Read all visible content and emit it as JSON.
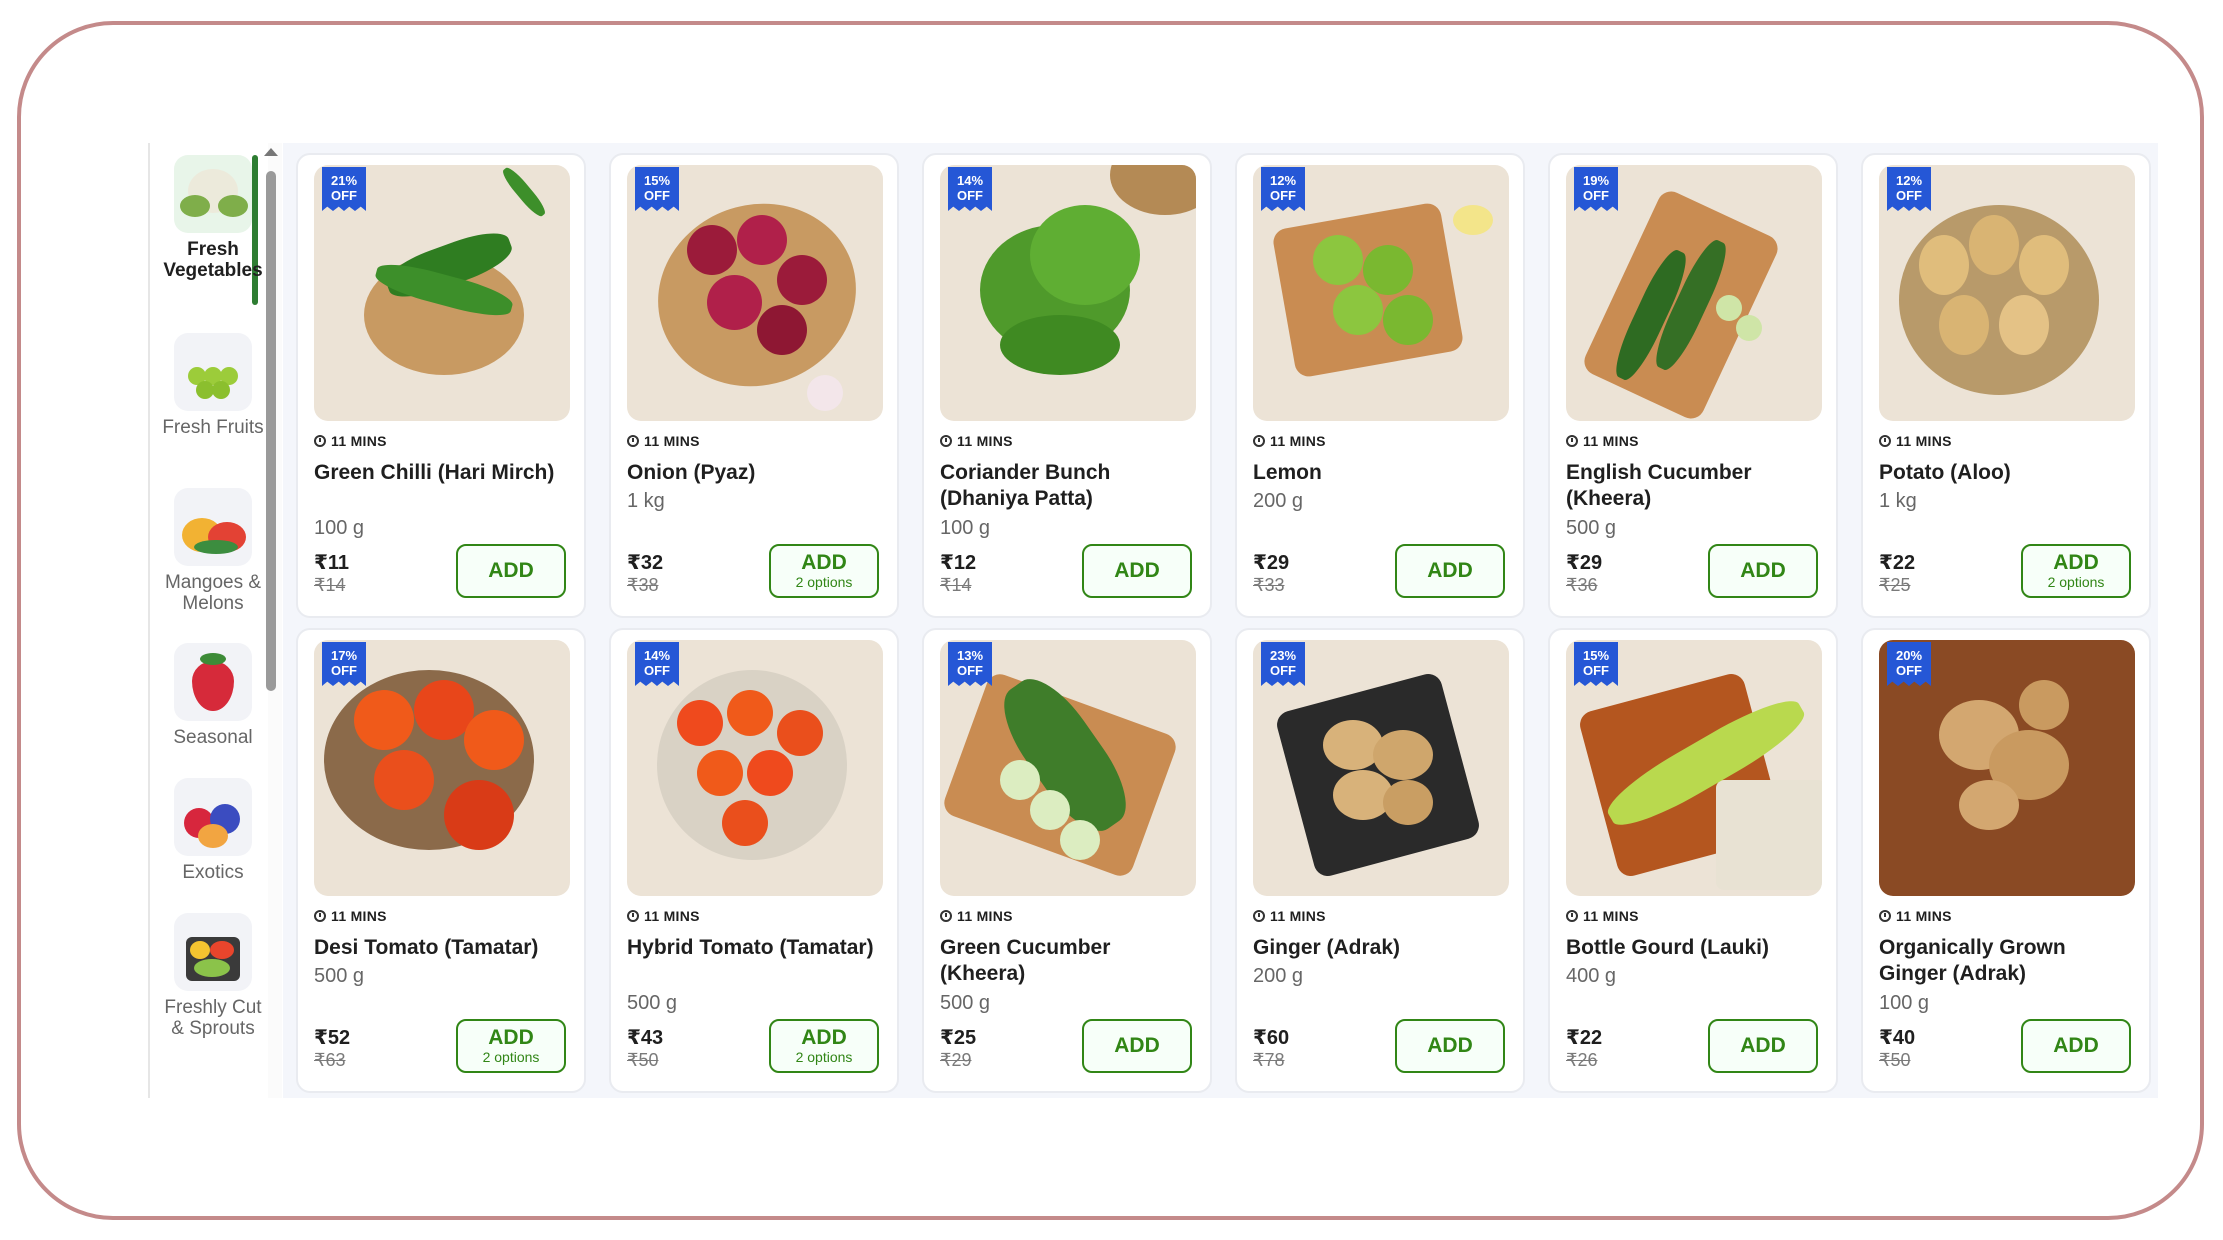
{
  "sidebar": {
    "categories": [
      {
        "label": "Fresh Vegetables",
        "icon": "cauliflower-icon",
        "active": true
      },
      {
        "label": "Fresh Fruits",
        "icon": "grapes-icon",
        "active": false
      },
      {
        "label": "Mangoes & Melons",
        "icon": "watermelon-icon",
        "active": false
      },
      {
        "label": "Seasonal",
        "icon": "strawberry-icon",
        "active": false
      },
      {
        "label": "Exotics",
        "icon": "berries-icon",
        "active": false
      },
      {
        "label": "Freshly Cut & Sprouts",
        "icon": "cut-fruit-box-icon",
        "active": false
      }
    ]
  },
  "products": [
    {
      "badge": "21%\nOFF",
      "eta": "11 MINS",
      "name": "Green Chilli (Hari Mirch)",
      "qty": "100 g",
      "price": "₹11",
      "mrp": "₹14",
      "add": "ADD",
      "options": ""
    },
    {
      "badge": "15%\nOFF",
      "eta": "11 MINS",
      "name": "Onion (Pyaz)",
      "qty": "1 kg",
      "price": "₹32",
      "mrp": "₹38",
      "add": "ADD",
      "options": "2 options"
    },
    {
      "badge": "14%\nOFF",
      "eta": "11 MINS",
      "name": "Coriander Bunch (Dhaniya Patta)",
      "qty": "100 g",
      "price": "₹12",
      "mrp": "₹14",
      "add": "ADD",
      "options": ""
    },
    {
      "badge": "12%\nOFF",
      "eta": "11 MINS",
      "name": "Lemon",
      "qty": "200 g",
      "price": "₹29",
      "mrp": "₹33",
      "add": "ADD",
      "options": ""
    },
    {
      "badge": "19%\nOFF",
      "eta": "11 MINS",
      "name": "English Cucumber (Kheera)",
      "qty": "500 g",
      "price": "₹29",
      "mrp": "₹36",
      "add": "ADD",
      "options": ""
    },
    {
      "badge": "12%\nOFF",
      "eta": "11 MINS",
      "name": "Potato (Aloo)",
      "qty": "1 kg",
      "price": "₹22",
      "mrp": "₹25",
      "add": "ADD",
      "options": "2 options"
    },
    {
      "badge": "17%\nOFF",
      "eta": "11 MINS",
      "name": "Desi Tomato (Tamatar)",
      "qty": "500 g",
      "price": "₹52",
      "mrp": "₹63",
      "add": "ADD",
      "options": "2 options"
    },
    {
      "badge": "14%\nOFF",
      "eta": "11 MINS",
      "name": "Hybrid Tomato (Tamatar)",
      "qty": "500 g",
      "price": "₹43",
      "mrp": "₹50",
      "add": "ADD",
      "options": "2 options"
    },
    {
      "badge": "13%\nOFF",
      "eta": "11 MINS",
      "name": "Green Cucumber (Kheera)",
      "qty": "500 g",
      "price": "₹25",
      "mrp": "₹29",
      "add": "ADD",
      "options": ""
    },
    {
      "badge": "23%\nOFF",
      "eta": "11 MINS",
      "name": "Ginger (Adrak)",
      "qty": "200 g",
      "price": "₹60",
      "mrp": "₹78",
      "add": "ADD",
      "options": ""
    },
    {
      "badge": "15%\nOFF",
      "eta": "11 MINS",
      "name": "Bottle Gourd (Lauki)",
      "qty": "400 g",
      "price": "₹22",
      "mrp": "₹26",
      "add": "ADD",
      "options": ""
    },
    {
      "badge": "20%\nOFF",
      "eta": "11 MINS",
      "name": "Organically Grown Ginger (Adrak)",
      "qty": "100 g",
      "price": "₹40",
      "mrp": "₹50",
      "add": "ADD",
      "options": ""
    }
  ],
  "colors": {
    "brand_green": "#318616",
    "badge_blue": "#2557d6",
    "frame_border": "#c48a8a"
  }
}
